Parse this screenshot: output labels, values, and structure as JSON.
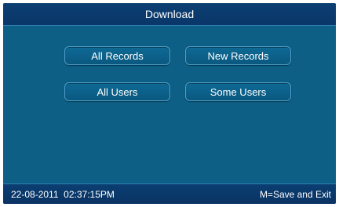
{
  "title": "Download",
  "buttons": {
    "all_records": "All Records",
    "new_records": "New Records",
    "all_users": "All Users",
    "some_users": "Some Users"
  },
  "status": {
    "datetime": "22-08-2011  02:37:15PM",
    "hint": "M=Save and Exit"
  },
  "colors": {
    "panel": "#0d5f86",
    "bar": "#0b3e72"
  }
}
